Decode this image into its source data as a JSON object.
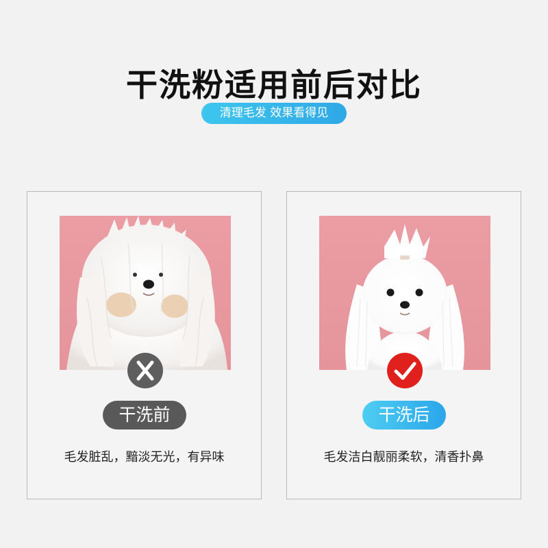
{
  "header": {
    "title": "干洗粉适用前后对比",
    "subtitle": "清理毛发 效果看得见"
  },
  "colors": {
    "background": "#f2f2f2",
    "accent_blue": "#2fa8e6",
    "badge_bad": "#5e5e5e",
    "badge_good": "#e0201d",
    "photo_bg": "#eb9da4"
  },
  "before": {
    "photo": "messy-white-dog-photo",
    "badge_icon": "x-icon",
    "label": "干洗前",
    "caption": "毛发脏乱，黯淡无光，有异味"
  },
  "after": {
    "photo": "clean-white-dog-photo",
    "badge_icon": "check-icon",
    "label": "干洗后",
    "caption": "毛发洁白靓丽柔软，清香扑鼻"
  }
}
